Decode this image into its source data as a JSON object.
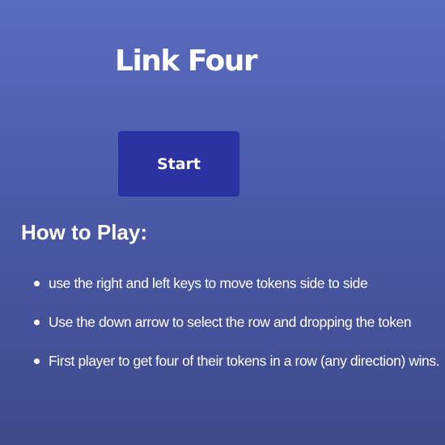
{
  "game": {
    "title": "Link Four",
    "start_label": "Start"
  },
  "instructions": {
    "heading": "How to Play:",
    "rules": [
      "use the right and left keys to move tokens side to side",
      "Use the down arrow to select the row and dropping the token",
      "First player to get four of their tokens in a row (any direction) wins."
    ]
  },
  "colors": {
    "background_top": "#5a6cc0",
    "background_bottom": "#3f4a8c",
    "button": "#2b33a3",
    "text": "#ffffff"
  }
}
